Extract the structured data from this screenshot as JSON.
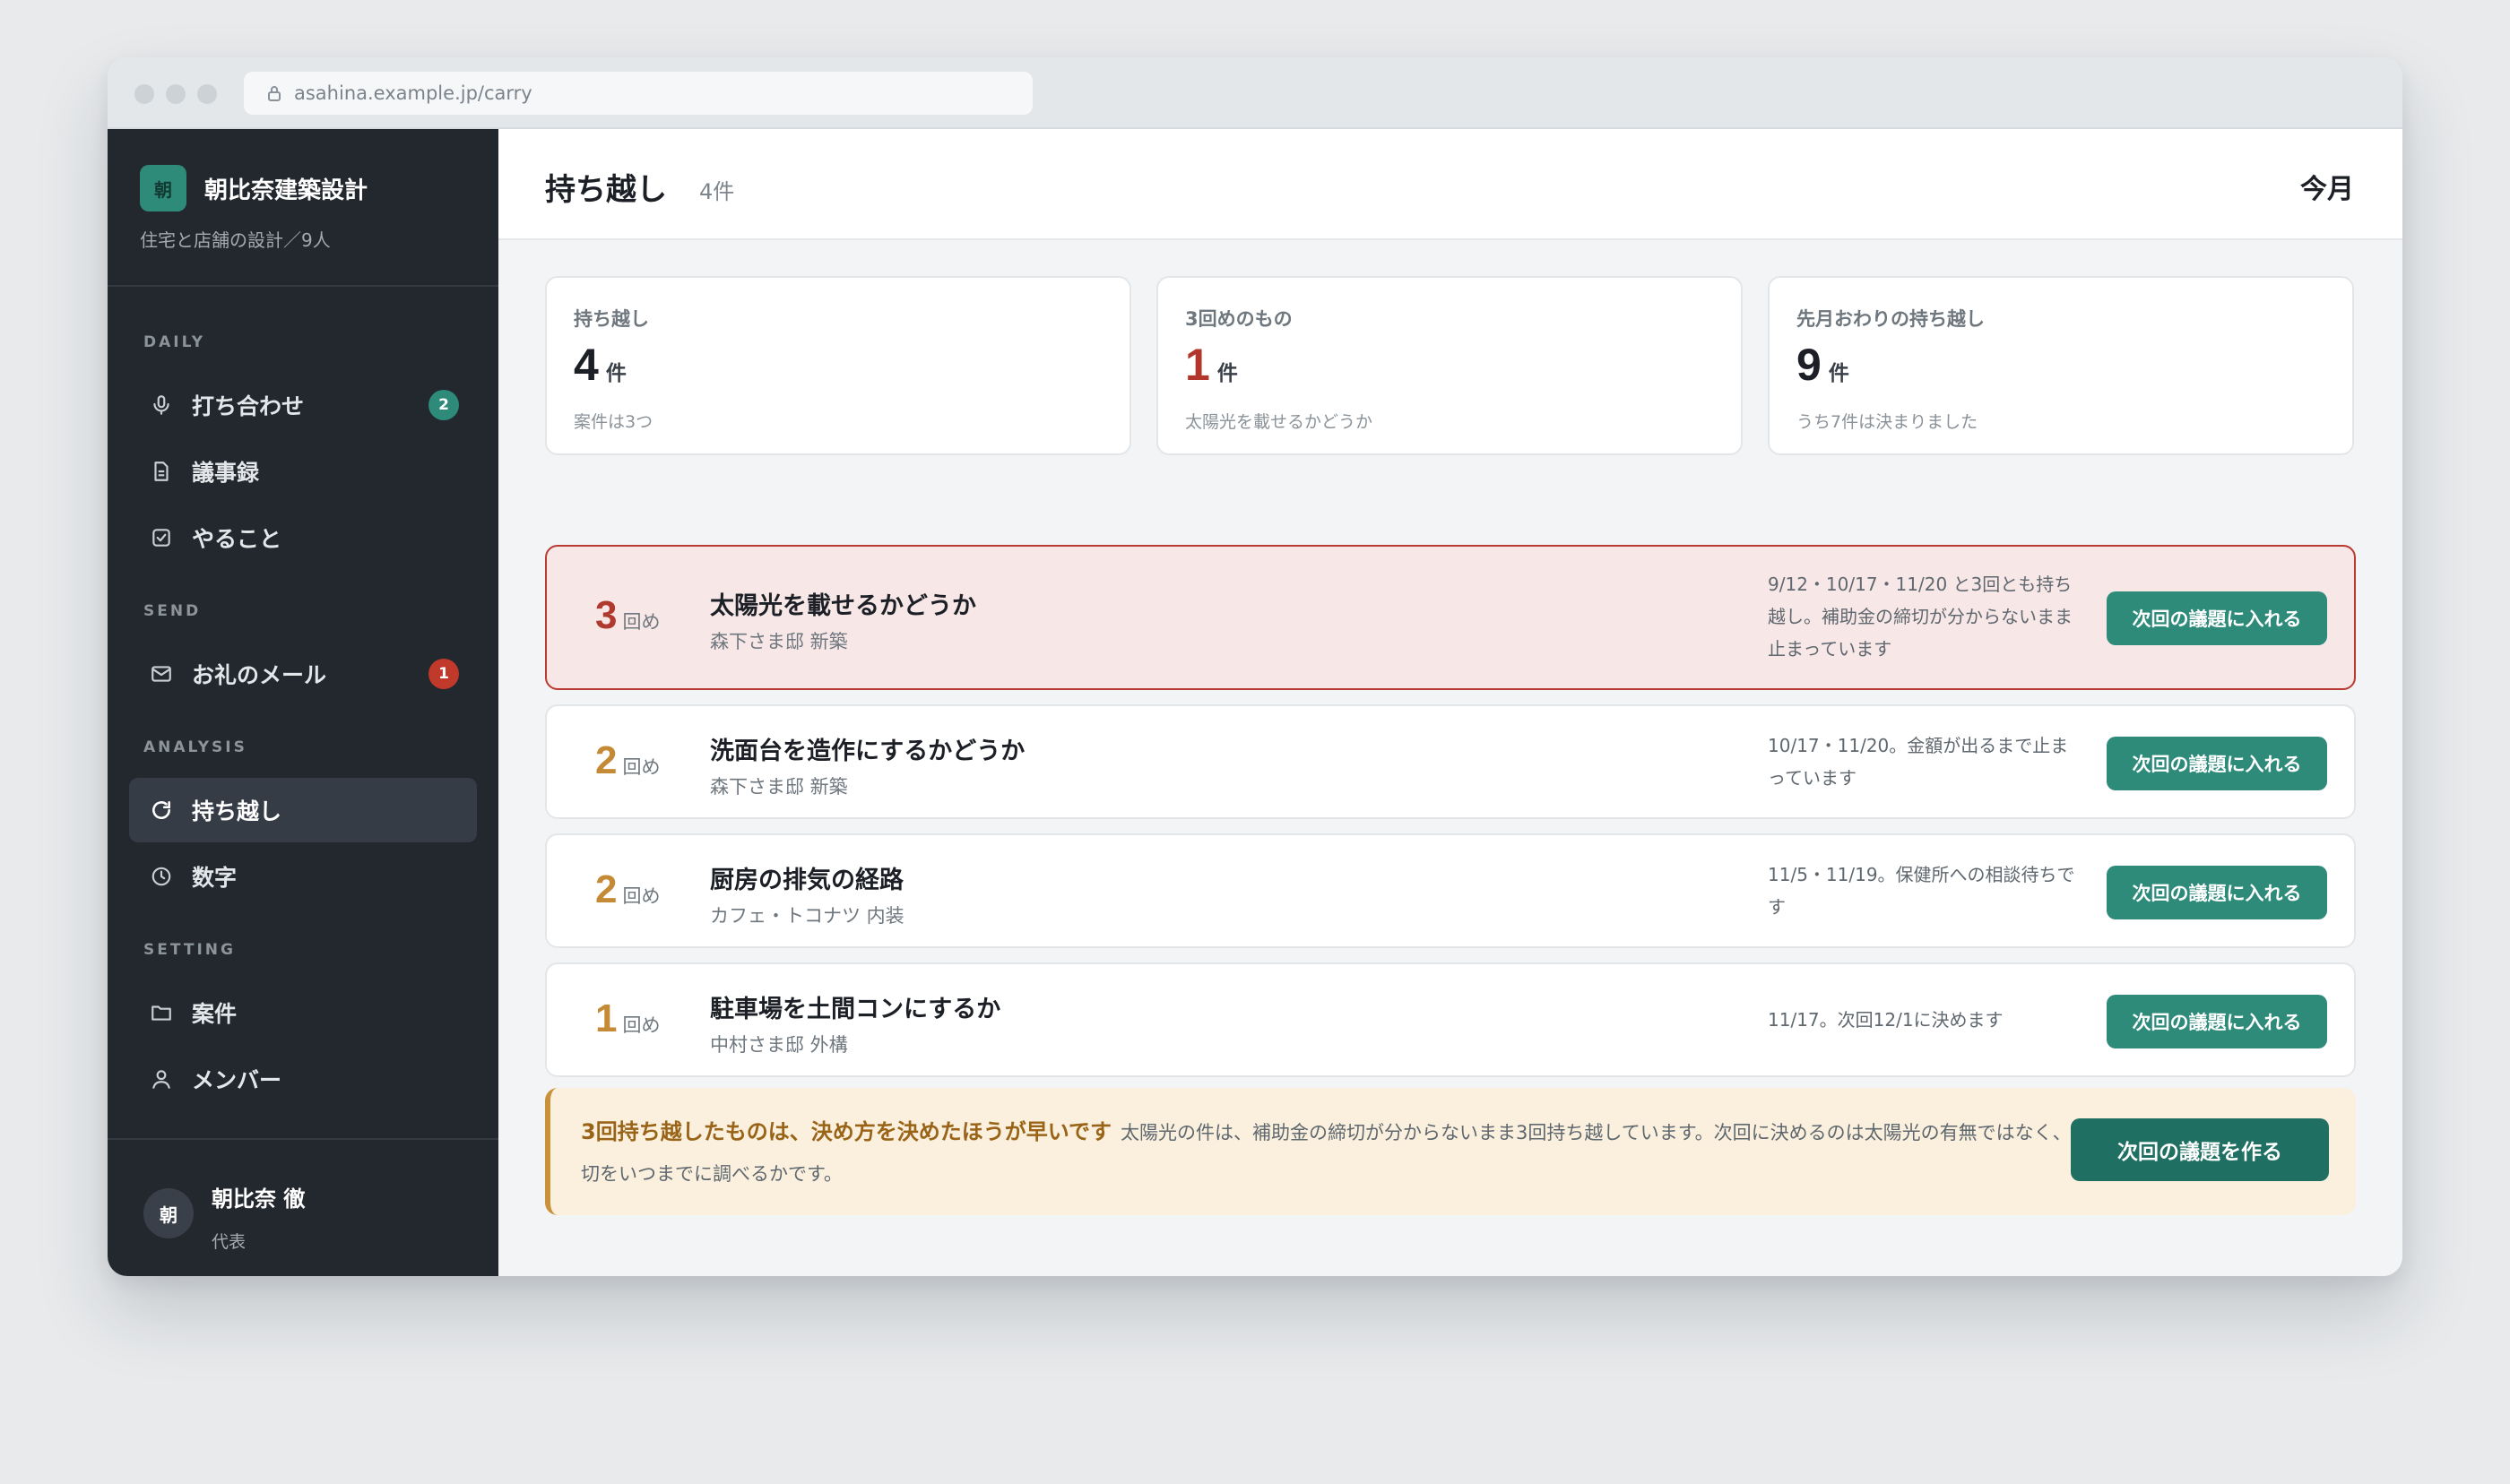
{
  "browser": {
    "url": "asahina.example.jp/carry"
  },
  "brand": {
    "logo_char": "朝",
    "name": "朝比奈建築設計",
    "subtitle": "住宅と店舗の設計／9人"
  },
  "sidebar": {
    "sections": {
      "daily": "DAILY",
      "send": "SEND",
      "analysis": "ANALYSIS",
      "setting": "SETTING"
    },
    "items": [
      {
        "label": "打ち合わせ",
        "icon": "microphone-icon",
        "badge": "2"
      },
      {
        "label": "議事録",
        "icon": "document-icon"
      },
      {
        "label": "やること",
        "icon": "checkbox-icon"
      },
      {
        "label": "お礼のメール",
        "icon": "mail-icon",
        "badge": "1"
      },
      {
        "label": "持ち越し",
        "icon": "refresh-icon",
        "active": true
      },
      {
        "label": "数字",
        "icon": "clock-icon"
      },
      {
        "label": "案件",
        "icon": "folder-icon"
      },
      {
        "label": "メンバー",
        "icon": "person-icon"
      }
    ]
  },
  "user": {
    "avatar_char": "朝",
    "name": "朝比奈 徹",
    "role": "代表"
  },
  "header": {
    "title": "持ち越し",
    "count": "4件",
    "period": "今月"
  },
  "stats": [
    {
      "label": "持ち越し",
      "value": "4",
      "unit": "件",
      "note": "案件は3つ"
    },
    {
      "label": "3回めのもの",
      "value": "1",
      "unit": "件",
      "note": "太陽光を載せるかどうか",
      "color": "#b3362c"
    },
    {
      "label": "先月おわりの持ち越し",
      "value": "9",
      "unit": "件",
      "note": "うち7件は決まりました"
    }
  ],
  "items": [
    {
      "round": "3",
      "round_unit": "回め",
      "title": "太陽光を載せるかどうか",
      "project": "森下さま邸 新築",
      "note": "9/12・10/17・11/20 と3回とも持ち越し。補助金の締切が分からないまま止まっています",
      "button": "次回の議題に入れる",
      "alert": true
    },
    {
      "round": "2",
      "round_unit": "回め",
      "title": "洗面台を造作にするかどうか",
      "project": "森下さま邸 新築",
      "note": "10/17・11/20。金額が出るまで止まっています",
      "button": "次回の議題に入れる"
    },
    {
      "round": "2",
      "round_unit": "回め",
      "title": "厨房の排気の経路",
      "project": "カフェ・トコナツ 内装",
      "note": "11/5・11/19。保健所への相談待ちです",
      "button": "次回の議題に入れる"
    },
    {
      "round": "1",
      "round_unit": "回め",
      "title": "駐車場を土間コンにするか",
      "project": "中村さま邸 外構",
      "note": "11/17。次回12/1に決めます",
      "button": "次回の議題に入れる"
    }
  ],
  "tip": {
    "headline": "3回持ち越したものは、決め方を決めたほうが早いです",
    "body": "太陽光の件は、補助金の締切が分からないまま3回持ち越しています。次回に決めるのは太陽光の有無ではなく、締切をいつまでに調べるかです。",
    "button": "次回の議題を作る"
  },
  "colors": {
    "accent": "#2e8b7a",
    "alert": "#b93a32",
    "warning": "#c58a36",
    "sidebar_bg": "#23272e"
  }
}
